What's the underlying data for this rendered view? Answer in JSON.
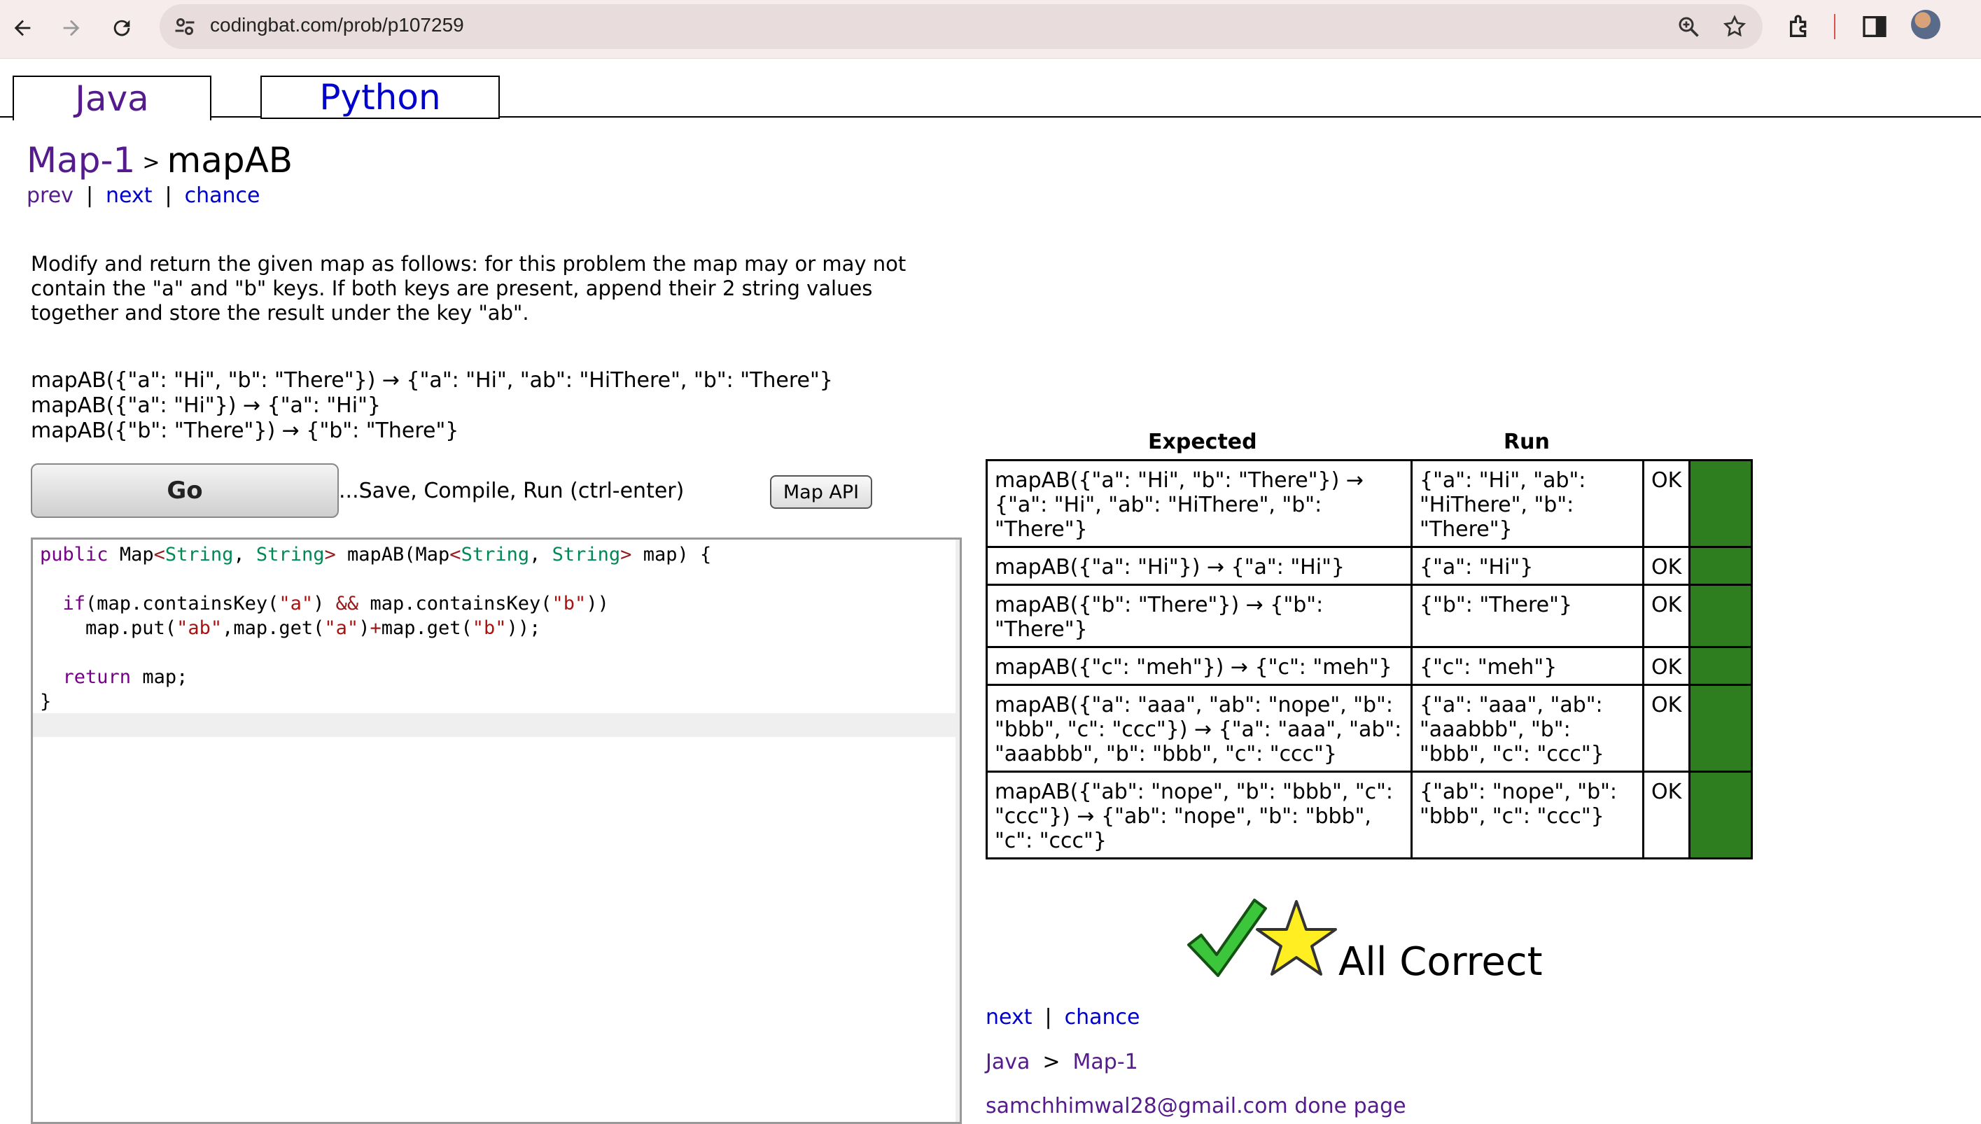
{
  "browser": {
    "url": "codingbat.com/prob/p107259"
  },
  "tabs": [
    {
      "label": "Java",
      "active": true
    },
    {
      "label": "Python",
      "active": false
    }
  ],
  "breadcrumb": {
    "section": "Map-1",
    "separator": ">",
    "problem": "mapAB"
  },
  "topnav": {
    "prev": "prev",
    "next": "next",
    "chance": "chance",
    "sep": "|"
  },
  "description": "Modify and return the given map as follows: for this problem the map may or may not contain the \"a\" and \"b\" keys. If both keys are present, append their 2 string values together and store the result under the key \"ab\".",
  "examples": [
    "mapAB({\"a\": \"Hi\", \"b\": \"There\"}) → {\"a\": \"Hi\", \"ab\": \"HiThere\", \"b\": \"There\"}",
    "mapAB({\"a\": \"Hi\"}) → {\"a\": \"Hi\"}",
    "mapAB({\"b\": \"There\"}) → {\"b\": \"There\"}"
  ],
  "actions": {
    "go_label": "Go",
    "go_hint": "...Save, Compile, Run (ctrl-enter)",
    "map_api_label": "Map API"
  },
  "results": {
    "header_expected": "Expected",
    "header_run": "Run",
    "rows": [
      {
        "expected": "mapAB({\"a\": \"Hi\", \"b\": \"There\"}) → {\"a\": \"Hi\", \"ab\": \"HiThere\", \"b\": \"There\"}",
        "run": "{\"a\": \"Hi\", \"ab\": \"HiThere\", \"b\": \"There\"}",
        "status": "OK"
      },
      {
        "expected": "mapAB({\"a\": \"Hi\"}) → {\"a\": \"Hi\"}",
        "run": "{\"a\": \"Hi\"}",
        "status": "OK"
      },
      {
        "expected": "mapAB({\"b\": \"There\"}) → {\"b\": \"There\"}",
        "run": "{\"b\": \"There\"}",
        "status": "OK"
      },
      {
        "expected": "mapAB({\"c\": \"meh\"}) → {\"c\": \"meh\"}",
        "run": "{\"c\": \"meh\"}",
        "status": "OK"
      },
      {
        "expected": "mapAB({\"a\": \"aaa\", \"ab\": \"nope\", \"b\": \"bbb\", \"c\": \"ccc\"}) → {\"a\": \"aaa\", \"ab\": \"aaabbb\", \"b\": \"bbb\", \"c\": \"ccc\"}",
        "run": "{\"a\": \"aaa\", \"ab\": \"aaabbb\", \"b\": \"bbb\", \"c\": \"ccc\"}",
        "status": "OK"
      },
      {
        "expected": "mapAB({\"ab\": \"nope\", \"b\": \"bbb\", \"c\": \"ccc\"}) → {\"ab\": \"nope\", \"b\": \"bbb\", \"c\": \"ccc\"}",
        "run": "{\"ab\": \"nope\", \"b\": \"bbb\", \"c\": \"ccc\"}",
        "status": "OK"
      }
    ],
    "pass_color": "#2e7d1f"
  },
  "verdict": {
    "text": "All Correct",
    "icons": [
      "checkmark-icon",
      "star-icon"
    ]
  },
  "bottom_nav": {
    "next": "next",
    "chance": "chance",
    "sep": "|"
  },
  "bottom_crumb": {
    "lang": "Java",
    "sep": ">",
    "section": "Map-1"
  },
  "user": {
    "email": "samchhimwal28@gmail.com",
    "done_page": "done page"
  }
}
